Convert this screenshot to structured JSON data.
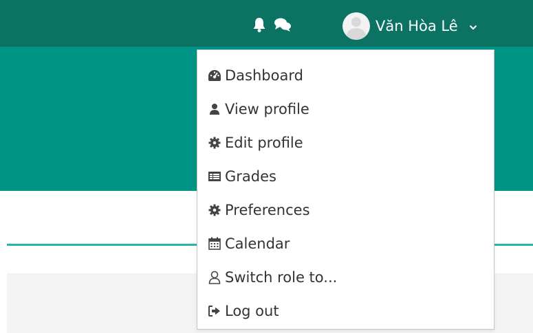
{
  "navbar": {
    "user_name": "Văn Hòa Lê",
    "icons": [
      "bell-icon",
      "chat-icon"
    ]
  },
  "menu": {
    "items": [
      {
        "label": "Dashboard",
        "icon": "dashboard-icon"
      },
      {
        "label": "View profile",
        "icon": "user-icon"
      },
      {
        "label": "Edit profile",
        "icon": "gear-icon"
      },
      {
        "label": "Grades",
        "icon": "table-icon"
      },
      {
        "label": "Preferences",
        "icon": "gear-icon"
      },
      {
        "label": "Calendar",
        "icon": "calendar-icon"
      },
      {
        "label": "Switch role to...",
        "icon": "user-outline-icon"
      },
      {
        "label": "Log out",
        "icon": "logout-icon"
      }
    ]
  },
  "colors": {
    "navbar": "#0b7264",
    "hero": "#009484",
    "accent_line": "#24b7a8",
    "menu_text": "#333333"
  }
}
